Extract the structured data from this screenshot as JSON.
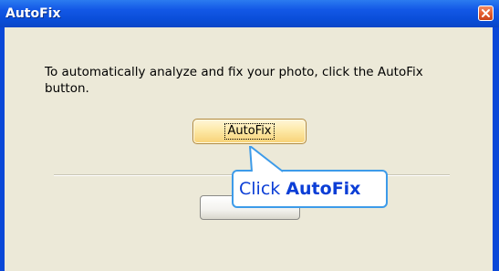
{
  "window": {
    "title": "AutoFix"
  },
  "dialog": {
    "message": "To automatically analyze and fix your photo, click the AutoFix button.",
    "autofix_button_label": "AutoFix",
    "ok_button_label": ""
  },
  "callout": {
    "prefix": "Click ",
    "emphasis": "AutoFix"
  },
  "colors": {
    "titlebar": "#0a4ed9",
    "client_background": "#ece9d8",
    "callout_border": "#3d9be9",
    "callout_text": "#0b3ed6",
    "close_button": "#e35b2d",
    "autofix_button": "#fde9a8"
  },
  "icons": {
    "close": "close-x-icon",
    "callout_pointer": "callout-pointer-icon"
  }
}
